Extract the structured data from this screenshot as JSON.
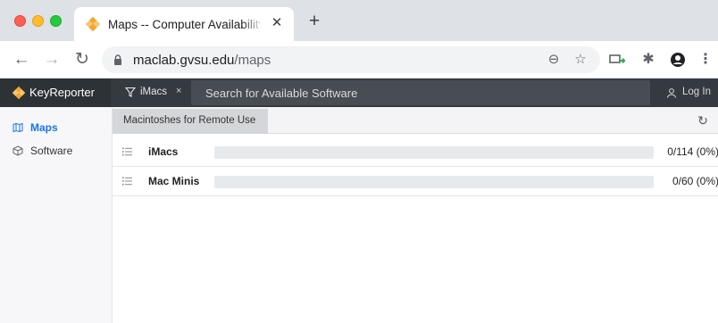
{
  "browser": {
    "tab_title": "Maps -- Computer Availability",
    "tab_close": "✕",
    "new_tab": "+",
    "url_host": "maclab.gvsu.edu",
    "url_path": "/maps"
  },
  "app": {
    "brand": "KeyReporter",
    "filter_label": "iMacs",
    "filter_remove": "×",
    "search_placeholder": "Search for Available Software",
    "login_label": "Log In",
    "accent_color": "#f0a830"
  },
  "sidebar": {
    "items": [
      {
        "label": "Maps",
        "icon": "map-icon",
        "active": true
      },
      {
        "label": "Software",
        "icon": "package-icon",
        "active": false
      }
    ]
  },
  "main": {
    "section_tab": "Macintoshes for Remote Use",
    "rows": [
      {
        "name": "iMacs",
        "count": "0/114 (0%)",
        "fraction": 0
      },
      {
        "name": "Mac Minis",
        "count": "0/60 (0%)",
        "fraction": 0
      }
    ]
  }
}
